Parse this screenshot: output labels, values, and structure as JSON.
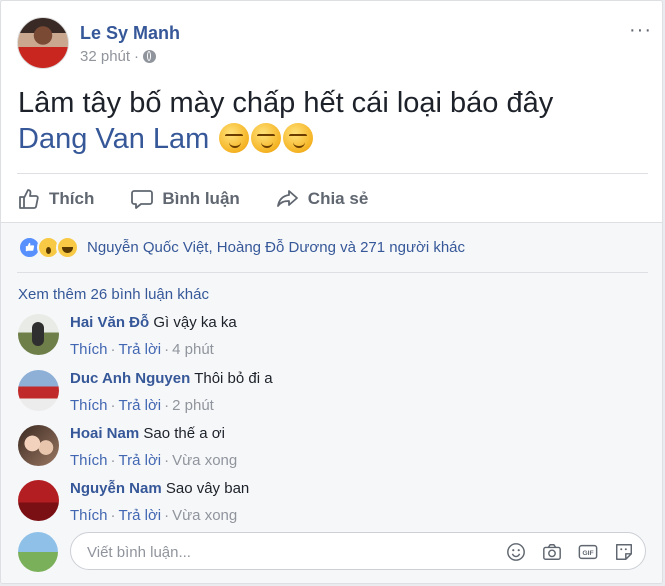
{
  "post": {
    "author": "Le Sy Manh",
    "time": "32 phút",
    "separator": "·",
    "more": "···",
    "text_line1": "Lâm tây bố mày chấp hết cái loại báo đây",
    "mention": "Dang Van Lam",
    "emoji_count": 3
  },
  "actions": {
    "like": "Thích",
    "comment": "Bình luận",
    "share": "Chia sẻ"
  },
  "reactions": {
    "icons": [
      "like-icon",
      "wow-icon",
      "haha-icon"
    ],
    "summary": "Nguyễn Quốc Việt, Hoàng Đỗ Dương và 271 người khác"
  },
  "comments_more": "Xem thêm 26 bình luận khác",
  "comments": [
    {
      "name": "Hai Văn Đỗ",
      "text": "Gì vậy ka ka",
      "like": "Thích",
      "reply": "Trả lời",
      "time": "4 phút"
    },
    {
      "name": "Duc Anh Nguyen",
      "text": "Thôi bỏ đi a",
      "like": "Thích",
      "reply": "Trả lời",
      "time": "2 phút"
    },
    {
      "name": "Hoai Nam",
      "text": "Sao thế a ơi",
      "like": "Thích",
      "reply": "Trả lời",
      "time": "Vừa xong"
    },
    {
      "name": "Nguyễn Nam",
      "text": "Sao vây ban",
      "like": "Thích",
      "reply": "Trả lời",
      "time": "Vừa xong"
    }
  ],
  "composer": {
    "placeholder": "Viết bình luận...",
    "tools": [
      "emoji-icon",
      "camera-icon",
      "gif-icon",
      "sticker-icon"
    ],
    "gif_label": "GIF"
  },
  "colors": {
    "link": "#365899",
    "muted": "#90949c",
    "action": "#606770",
    "background": "#f6f7f9"
  }
}
